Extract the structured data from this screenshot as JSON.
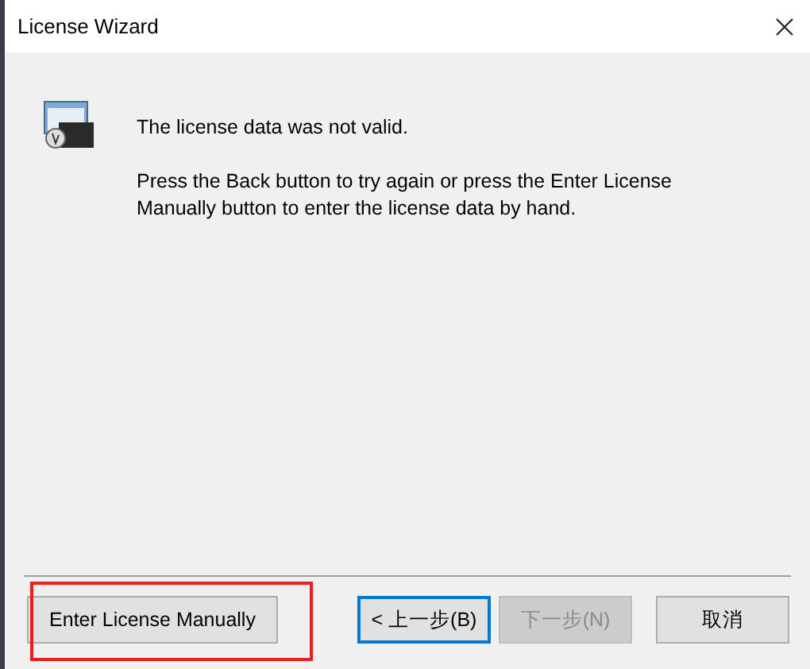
{
  "window": {
    "title": "License Wizard"
  },
  "message": {
    "heading": "The license data was not valid.",
    "body": "Press the Back button to try again or press the Enter License Manually button to enter the license data by hand."
  },
  "buttons": [
    {
      "label": "Enter License Manually",
      "disabled": false,
      "focused": false,
      "highlighted": true
    },
    {
      "label": "< 上一步(B)",
      "disabled": false,
      "focused": true,
      "highlighted": false
    },
    {
      "label": "下一步(N)",
      "disabled": true,
      "focused": false,
      "highlighted": false
    },
    {
      "label": "取消",
      "disabled": false,
      "focused": false,
      "highlighted": false
    }
  ]
}
